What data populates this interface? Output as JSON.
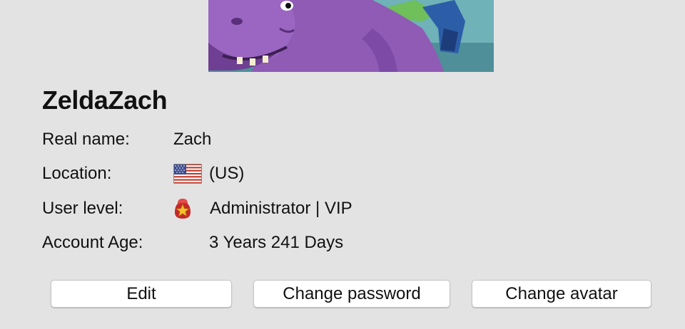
{
  "profile": {
    "username": "ZeldaZach",
    "avatar_icon": "purple-hippo-avatar-image"
  },
  "info": {
    "real_name_label": "Real name:",
    "real_name_value": "Zach",
    "location_label": "Location:",
    "location_flag_icon": "us-flag-icon",
    "location_value": "(US)",
    "user_level_label": "User level:",
    "user_level_icon": "admin-badge-icon",
    "user_level_value": "Administrator | VIP",
    "account_age_label": "Account Age:",
    "account_age_value": "3 Years 241 Days"
  },
  "buttons": {
    "edit": "Edit",
    "change_password": "Change password",
    "change_avatar": "Change avatar"
  },
  "colors": {
    "background": "#e3e3e3",
    "button_background": "#ffffff",
    "avatar_purple": "#8f5bb5"
  }
}
